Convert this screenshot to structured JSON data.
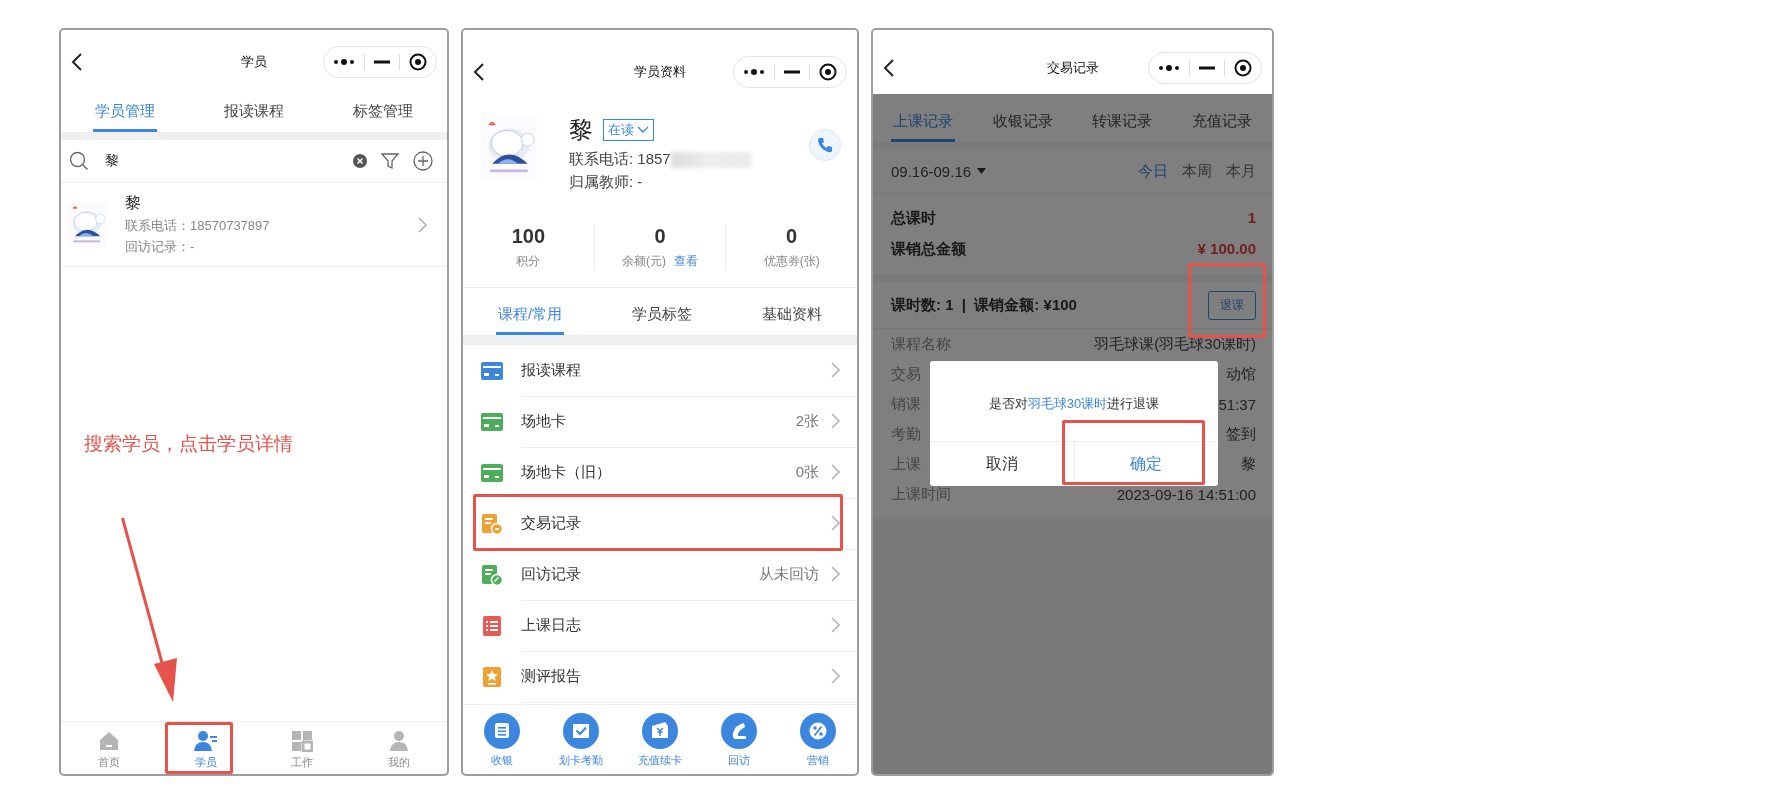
{
  "student_list": {
    "nav": {
      "title": "学员"
    },
    "tabs": [
      {
        "label": "学员管理",
        "selected": true
      },
      {
        "label": "报读课程",
        "selected": false
      },
      {
        "label": "标签管理",
        "selected": false
      }
    ],
    "search": {
      "value": "黎"
    },
    "students": [
      {
        "name": "黎",
        "phone": "联系电话：18570737897",
        "visit": "回访记录：-"
      }
    ],
    "annotation": "搜索学员，点击学员详情",
    "bottom_tabs": [
      {
        "label": "首页",
        "selected": false,
        "highlighted": false
      },
      {
        "label": "学员",
        "selected": true,
        "highlighted": true
      },
      {
        "label": "工作",
        "selected": false,
        "highlighted": false
      },
      {
        "label": "我的",
        "selected": false,
        "highlighted": false
      }
    ]
  },
  "student_profile": {
    "nav": {
      "title": "学员资料"
    },
    "name": "黎",
    "status": "在读",
    "phone": "联系电话: 1857",
    "teacher": "归属教师: -",
    "stats": [
      {
        "value": "100",
        "label": "积分"
      },
      {
        "value": "0",
        "label": "余额(元)",
        "link": "查看"
      },
      {
        "value": "0",
        "label": "优惠券(张)"
      }
    ],
    "tabs": [
      {
        "label": "课程/常用",
        "selected": true
      },
      {
        "label": "学员标签",
        "selected": false
      },
      {
        "label": "基础资料",
        "selected": false
      }
    ],
    "menu": [
      {
        "label": "报读课程",
        "color": "#3d86dd",
        "highlighted": false
      },
      {
        "label": "场地卡",
        "value": "2张",
        "color": "#4cae5a",
        "highlighted": false
      },
      {
        "label": "场地卡（旧）",
        "value": "0张",
        "color": "#4cae5a",
        "highlighted": false
      },
      {
        "label": "交易记录",
        "color": "#f0a030",
        "highlighted": true
      },
      {
        "label": "回访记录",
        "value": "从未回访",
        "color": "#4cae5a",
        "highlighted": false
      },
      {
        "label": "上课日志",
        "color": "#e85a55",
        "highlighted": false
      },
      {
        "label": "测评报告",
        "color": "#f0a030",
        "highlighted": false
      }
    ],
    "actions": [
      {
        "label": "收银"
      },
      {
        "label": "划卡考勤"
      },
      {
        "label": "充值续卡"
      },
      {
        "label": "回访"
      },
      {
        "label": "营销"
      }
    ]
  },
  "transaction_records": {
    "nav": {
      "title": "交易记录"
    },
    "tabs": [
      {
        "label": "上课记录",
        "selected": true
      },
      {
        "label": "收银记录",
        "selected": false
      },
      {
        "label": "转课记录",
        "selected": false
      },
      {
        "label": "充值记录",
        "selected": false
      }
    ],
    "date_range": "09.16-09.16",
    "periods": [
      {
        "label": "今日",
        "selected": true
      },
      {
        "label": "本周",
        "selected": false
      },
      {
        "label": "本月",
        "selected": false
      }
    ],
    "summary": [
      {
        "label": "总课时",
        "value": "1"
      },
      {
        "label": "课销总金额",
        "value": "¥ 100.00"
      }
    ],
    "record": {
      "header": "课时数: 1  |  课销金额: ¥100",
      "button": {
        "label": "退课",
        "highlighted": true
      },
      "details": [
        {
          "label": "课程名称",
          "value": "羽毛球课(羽毛球30课时)"
        },
        {
          "label": "交易",
          "value": "动馆"
        },
        {
          "label": "销课",
          "value": "51:37"
        },
        {
          "label": "考勤",
          "value": "签到"
        },
        {
          "label": "上课",
          "value": "黎"
        },
        {
          "label": "上课时间",
          "value": "2023-09-16 14:51:00"
        }
      ]
    },
    "dialog": {
      "message_before": "是否对",
      "message_highlight": "羽毛球30课时",
      "message_after": "进行退课",
      "buttons": [
        {
          "label": "取消",
          "kind": "cancel",
          "highlighted": false
        },
        {
          "label": "确定",
          "kind": "confirm",
          "highlighted": true
        }
      ]
    }
  }
}
